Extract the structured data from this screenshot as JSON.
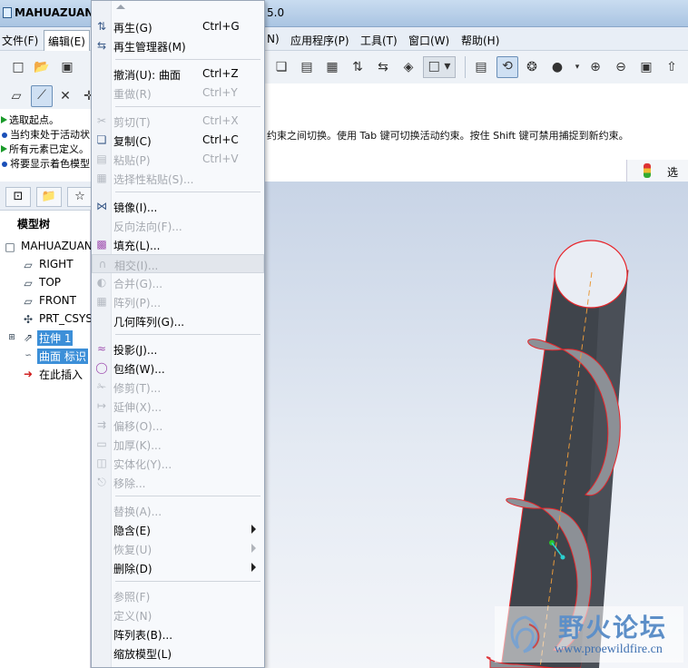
{
  "window": {
    "title": "MAHUAZUAN",
    "title_suffix": "5.0"
  },
  "menubar": {
    "items": [
      {
        "label": "文件(F)"
      },
      {
        "label": "编辑(E)"
      },
      {
        "label": "N)"
      },
      {
        "label": "应用程序(P)"
      },
      {
        "label": "工具(T)"
      },
      {
        "label": "窗口(W)"
      },
      {
        "label": "帮助(H)"
      }
    ]
  },
  "messages": {
    "lines": [
      {
        "icon": "green-arrow-icon",
        "text": "选取起点。"
      },
      {
        "icon": "blue-dot-icon",
        "text": "当约束处于活动状"
      },
      {
        "icon": "green-arrow-icon",
        "text": "所有元素已定义。"
      },
      {
        "icon": "blue-dot-icon",
        "text": "将要显示着色模型"
      }
    ],
    "continuation": "约束之间切换。使用 Tab 键可切换活动约束。按住 Shift 键可禁用捕捉到新约束。"
  },
  "filter": {
    "label": "选取"
  },
  "model_tree": {
    "title": "模型树",
    "items": [
      {
        "label": "MAHUAZUAN",
        "icon": "part-icon"
      },
      {
        "label": "RIGHT",
        "icon": "datum-plane-icon"
      },
      {
        "label": "TOP",
        "icon": "datum-plane-icon"
      },
      {
        "label": "FRONT",
        "icon": "datum-plane-icon"
      },
      {
        "label": "PRT_CSYS",
        "icon": "csys-icon"
      },
      {
        "label": "拉伸 1",
        "icon": "extrude-icon"
      },
      {
        "label": "曲面 标识",
        "icon": "surface-icon"
      },
      {
        "label": "在此插入",
        "icon": "insert-arrow-icon"
      }
    ]
  },
  "edit_menu": {
    "items": [
      {
        "label": "再生(G)",
        "shortcut": "Ctrl+G",
        "icon": "regenerate-icon",
        "enabled": true
      },
      {
        "label": "再生管理器(M)",
        "shortcut": "",
        "icon": "regen-manager-icon",
        "enabled": true
      },
      {
        "label": "撤消(U):  曲面",
        "shortcut": "Ctrl+Z",
        "icon": "",
        "enabled": true
      },
      {
        "label": "重做(R)",
        "shortcut": "Ctrl+Y",
        "icon": "",
        "enabled": false
      },
      {
        "label": "剪切(T)",
        "shortcut": "Ctrl+X",
        "icon": "scissors-icon",
        "enabled": false
      },
      {
        "label": "复制(C)",
        "shortcut": "Ctrl+C",
        "icon": "copy-icon",
        "enabled": true
      },
      {
        "label": "粘贴(P)",
        "shortcut": "Ctrl+V",
        "icon": "paste-icon",
        "enabled": false
      },
      {
        "label": "选择性粘贴(S)...",
        "shortcut": "",
        "icon": "paste-special-icon",
        "enabled": false
      },
      {
        "label": "镜像(I)...",
        "shortcut": "",
        "icon": "mirror-icon",
        "enabled": true
      },
      {
        "label": "反向法向(F)...",
        "shortcut": "",
        "icon": "",
        "enabled": false
      },
      {
        "label": "填充(L)...",
        "shortcut": "",
        "icon": "fill-icon",
        "enabled": true
      },
      {
        "label": "相交(I)...",
        "shortcut": "",
        "icon": "intersect-icon",
        "enabled": false
      },
      {
        "label": "合并(G)...",
        "shortcut": "",
        "icon": "merge-icon",
        "enabled": false
      },
      {
        "label": "阵列(P)...",
        "shortcut": "",
        "icon": "pattern-icon",
        "enabled": false
      },
      {
        "label": "几何阵列(G)...",
        "shortcut": "",
        "icon": "",
        "enabled": true
      },
      {
        "label": "投影(J)...",
        "shortcut": "",
        "icon": "project-icon",
        "enabled": true
      },
      {
        "label": "包络(W)...",
        "shortcut": "",
        "icon": "wrap-icon",
        "enabled": true
      },
      {
        "label": "修剪(T)...",
        "shortcut": "",
        "icon": "trim-icon",
        "enabled": false
      },
      {
        "label": "延伸(X)...",
        "shortcut": "",
        "icon": "extend-icon",
        "enabled": false
      },
      {
        "label": "偏移(O)...",
        "shortcut": "",
        "icon": "offset-icon",
        "enabled": false
      },
      {
        "label": "加厚(K)...",
        "shortcut": "",
        "icon": "thicken-icon",
        "enabled": false
      },
      {
        "label": "实体化(Y)...",
        "shortcut": "",
        "icon": "solidify-icon",
        "enabled": false
      },
      {
        "label": "移除...",
        "shortcut": "",
        "icon": "remove-icon",
        "enabled": false
      },
      {
        "label": "替换(A)...",
        "shortcut": "",
        "icon": "",
        "enabled": false
      },
      {
        "label": "隐含(E)",
        "shortcut": "",
        "icon": "",
        "enabled": true,
        "submenu": true
      },
      {
        "label": "恢复(U)",
        "shortcut": "",
        "icon": "",
        "enabled": false,
        "submenu": true
      },
      {
        "label": "删除(D)",
        "shortcut": "",
        "icon": "",
        "enabled": true,
        "submenu": true
      },
      {
        "label": "参照(F)",
        "shortcut": "",
        "icon": "",
        "enabled": false
      },
      {
        "label": "定义(N)",
        "shortcut": "",
        "icon": "",
        "enabled": false
      },
      {
        "label": "阵列表(B)...",
        "shortcut": "",
        "icon": "",
        "enabled": true
      },
      {
        "label": "缩放模型(L)",
        "shortcut": "",
        "icon": "",
        "enabled": true
      }
    ]
  },
  "watermark": {
    "brand": "野火论坛",
    "url": "www.proewildfire.cn"
  },
  "colors": {
    "model_dark": "#3f444b",
    "model_edge": "#e8252a",
    "highlight_blue": "#3c8fd8"
  }
}
